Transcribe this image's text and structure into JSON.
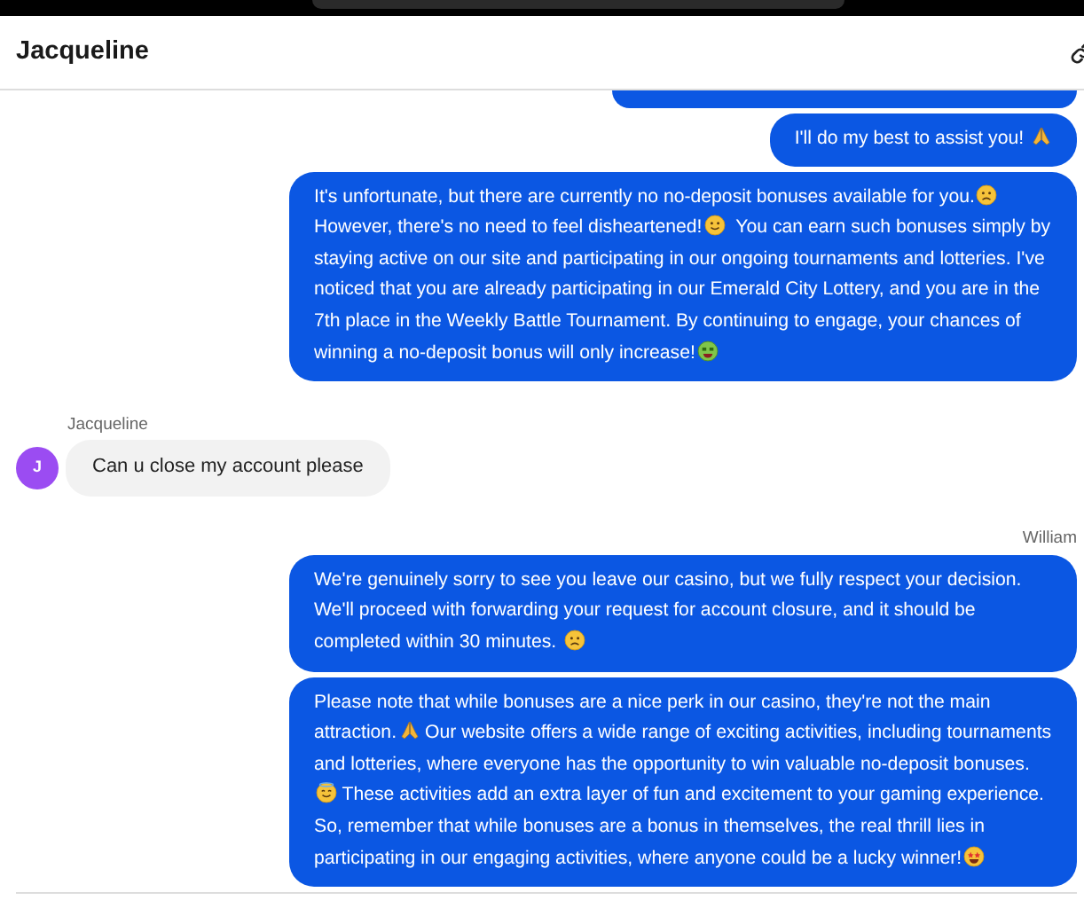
{
  "header": {
    "title": "Jacqueline"
  },
  "thread": [
    {
      "kind": "agent",
      "clipped_above": true,
      "messages": [
        [
          {
            "kind": "text",
            "text": "I'll do my best to assist you! "
          },
          {
            "kind": "pray"
          }
        ],
        [
          {
            "kind": "text",
            "text": "It's unfortunate, but there are currently no no-deposit bonuses available for you."
          },
          {
            "kind": "sad"
          },
          {
            "kind": "text",
            "text": " However, there's no need to feel disheartened!"
          },
          {
            "kind": "smile"
          },
          {
            "kind": "text",
            "text": "  You can earn such bonuses simply by staying active on our site and participating in our ongoing tournaments and lotteries. I've noticed that you are already participating in our Emerald City Lottery, and you are in the 7th place in the Weekly Battle Tournament. By continuing to engage, your chances of winning a no-deposit bonus will only increase!"
          },
          {
            "kind": "money"
          }
        ]
      ]
    },
    {
      "kind": "customer",
      "sender": "Jacqueline",
      "avatar": "J",
      "messages": [
        [
          {
            "kind": "text",
            "text": "Can u close my account please"
          }
        ]
      ]
    },
    {
      "kind": "agent",
      "sender": "William",
      "messages": [
        [
          {
            "kind": "text",
            "text": "We're genuinely sorry to see you leave our casino, but we fully respect your decision. We'll proceed with forwarding your request for account closure, and it should be completed within 30 minutes. "
          },
          {
            "kind": "sad"
          }
        ],
        [
          {
            "kind": "text",
            "text": "Please note that while bonuses are a nice perk in our casino, they're not the main attraction."
          },
          {
            "kind": "pray"
          },
          {
            "kind": "text",
            "text": " Our website offers a wide range of exciting activities, including tournaments and lotteries, where everyone has the opportunity to win valuable no-deposit bonuses."
          },
          {
            "kind": "halo"
          },
          {
            "kind": "text",
            "text": " These activities add an extra layer of fun and excitement to your gaming experience. So, remember that while bonuses are a bonus in themselves, the real thrill lies in participating in our engaging activities, where anyone could be a lucky winner!"
          },
          {
            "kind": "star-eyes"
          }
        ]
      ]
    }
  ]
}
